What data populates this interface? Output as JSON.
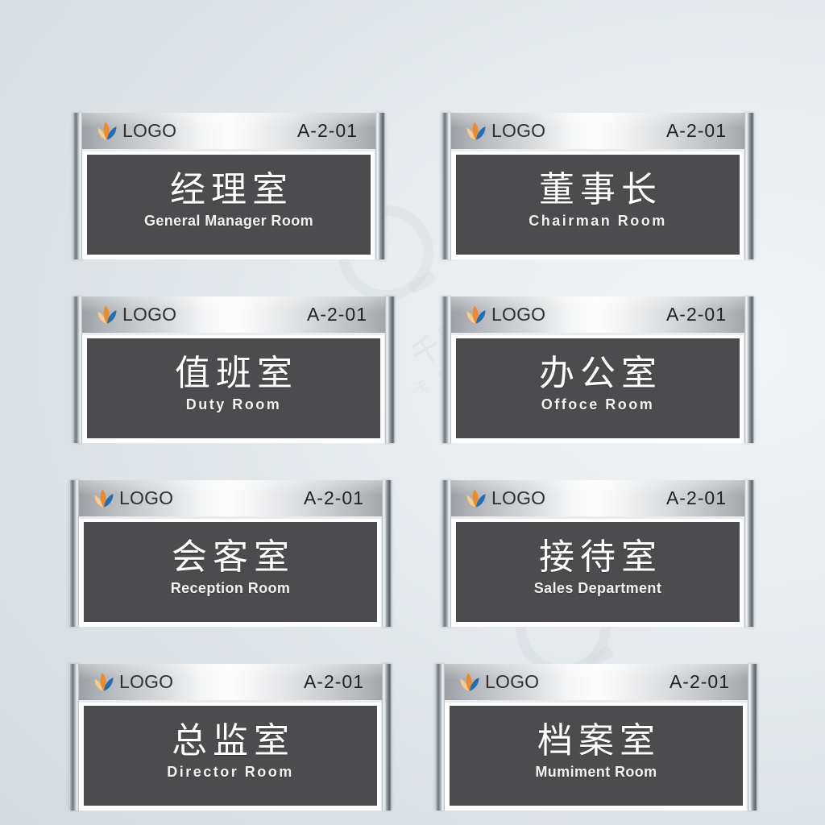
{
  "page": {
    "title": "Office Door Sign Mockup Set",
    "background_color": "#e6eaee",
    "panel_color": "#4c4c4f",
    "logo_colors": {
      "petal_light": "#f7c884",
      "petal_orange": "#f08a28",
      "petal_blue": "#1e6fb8"
    }
  },
  "watermark": {
    "brand": "千图网",
    "tagline": "无 忧 设 计 无 忧 享",
    "icon": "circle-q-watermark-icon"
  },
  "common": {
    "logo_label": "LOGO",
    "logo_icon": "lotus-flower-logo-icon",
    "room_code": "A-2-01"
  },
  "signs": [
    {
      "id": "sign-general-manager-room",
      "cn": "经理室",
      "en": "General Manager Room",
      "en_spaced": false,
      "logo_label": "LOGO",
      "room_code": "A-2-01"
    },
    {
      "id": "sign-chairman-room",
      "cn": "董事长",
      "en": "Chairman Room",
      "en_spaced": true,
      "logo_label": "LOGO",
      "room_code": "A-2-01"
    },
    {
      "id": "sign-duty-room",
      "cn": "值班室",
      "en": "Duty Room",
      "en_spaced": true,
      "logo_label": "LOGO",
      "room_code": "A-2-01"
    },
    {
      "id": "sign-office-room",
      "cn": "办公室",
      "en": "Offoce Room",
      "en_spaced": true,
      "logo_label": "LOGO",
      "room_code": "A-2-01"
    },
    {
      "id": "sign-reception-room",
      "cn": "会客室",
      "en": "Reception Room",
      "en_spaced": false,
      "logo_label": "LOGO",
      "room_code": "A-2-01"
    },
    {
      "id": "sign-sales-department",
      "cn": "接待室",
      "en": "Sales Department",
      "en_spaced": false,
      "logo_label": "LOGO",
      "room_code": "A-2-01"
    },
    {
      "id": "sign-director-room",
      "cn": "总监室",
      "en": "Director Room",
      "en_spaced": true,
      "logo_label": "LOGO",
      "room_code": "A-2-01"
    },
    {
      "id": "sign-muniment-room",
      "cn": "档案室",
      "en": "Mumiment Room",
      "en_spaced": false,
      "logo_label": "LOGO",
      "room_code": "A-2-01"
    }
  ]
}
